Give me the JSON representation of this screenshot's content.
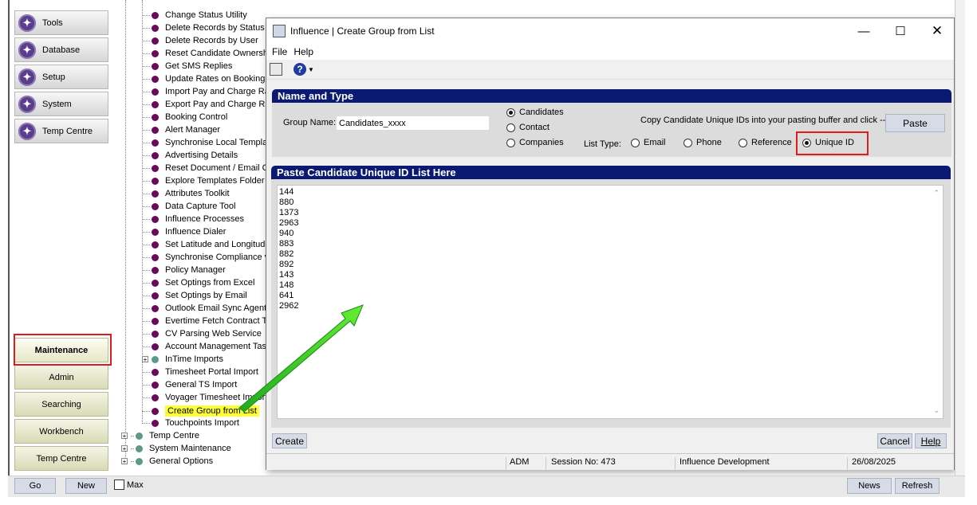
{
  "nav": {
    "buttons": [
      {
        "label": "Tools"
      },
      {
        "label": "Database"
      },
      {
        "label": "Setup"
      },
      {
        "label": "System"
      },
      {
        "label": "Temp Centre"
      }
    ],
    "categories": [
      {
        "label": "Maintenance"
      },
      {
        "label": "Admin"
      },
      {
        "label": "Searching"
      },
      {
        "label": "Workbench"
      },
      {
        "label": "Temp Centre"
      }
    ]
  },
  "tree": {
    "items": [
      "Change Status Utility",
      "Delete Records by Status",
      "Delete Records by User",
      "Reset Candidate Ownership",
      "Get SMS Replies",
      "Update Rates on Bookings",
      "Import Pay and Charge Rates",
      "Export Pay and Charge Rates",
      "Booking Control",
      "Alert Manager",
      "Synchronise Local Templates",
      "Advertising Details",
      "Reset Document / Email Co",
      "Explore Templates Folder",
      "Attributes Toolkit",
      "Data Capture Tool",
      "Influence Processes",
      "Influence Dialer",
      "Set Latitude and Longitude",
      "Synchronise Compliance v",
      "Policy Manager",
      "Set Optings from Excel",
      "Set Optings by Email",
      "Outlook Email Sync Agent",
      "Evertime Fetch Contract Ti",
      "CV Parsing Web Service",
      "Account Management Tas",
      "InTime Imports",
      "Timesheet Portal Import",
      "General TS Import",
      "Voyager Timesheet Import",
      "Create Group from List",
      "Touchpoints Import"
    ],
    "root_items": [
      "Temp Centre",
      "System Maintenance",
      "General Options"
    ]
  },
  "dialog": {
    "title": "Influence | Create Group from List",
    "menu": {
      "file": "File",
      "help": "Help"
    },
    "section1": "Name and Type",
    "group_name_label": "Group Name:",
    "group_name_value": "Candidates_xxxx",
    "types": [
      "Candidates",
      "Contact",
      "Companies"
    ],
    "selected_type": "Candidates",
    "copy_hint": "Copy Candidate Unique IDs into your pasting buffer and click -->",
    "paste_label": "Paste",
    "list_type_label": "List Type:",
    "list_types": [
      "Email",
      "Phone",
      "Reference",
      "Unique ID"
    ],
    "selected_list_type": "Unique ID",
    "section2": "Paste Candidate Unique ID List Here",
    "ids": [
      "144",
      "880",
      "1373",
      "2963",
      "940",
      "883",
      "882",
      "892",
      "143",
      "148",
      "641",
      "2962"
    ],
    "create_label": "Create",
    "cancel_label": "Cancel",
    "help_label": "Help",
    "status": {
      "user": "ADM",
      "session": "Session No: 473",
      "db": "Influence Development",
      "date": "26/08/2025"
    }
  },
  "bottom": {
    "go": "Go",
    "new": "New",
    "max": "Max",
    "news": "News",
    "refresh": "Refresh"
  },
  "colors": {
    "header": "#0a1a73",
    "highlight": "#ffff33",
    "callout": "#e01b1b",
    "arrow": "#22cc22"
  }
}
